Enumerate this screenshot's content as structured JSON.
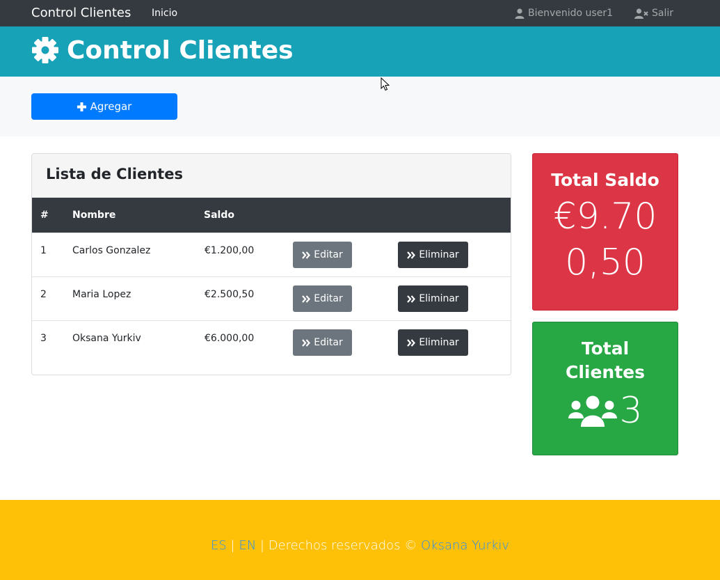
{
  "navbar": {
    "brand": "Control Clientes",
    "home": "Inicio",
    "welcome": "Bienvenido user1",
    "logout": "Salir",
    "user_icon": "user-icon",
    "logout_icon": "user-times-icon"
  },
  "header": {
    "title": "Control Clientes",
    "icon": "gear-icon"
  },
  "actions": {
    "add_label": "Agregar",
    "add_icon": "plus-icon"
  },
  "clients_card": {
    "title": "Lista de Clientes",
    "columns": [
      "#",
      "Nombre",
      "Saldo"
    ],
    "rows": [
      {
        "id": "1",
        "name": "Carlos Gonzalez",
        "balance": "€1.200,00",
        "edit": "Editar",
        "delete": "Eliminar"
      },
      {
        "id": "2",
        "name": "Maria Lopez",
        "balance": "€2.500,50",
        "edit": "Editar",
        "delete": "Eliminar"
      },
      {
        "id": "3",
        "name": "Oksana Yurkiv",
        "balance": "€6.000,00",
        "edit": "Editar",
        "delete": "Eliminar"
      }
    ]
  },
  "stats": {
    "total_balance_title": "Total Saldo",
    "total_balance_value": "€9.700,50",
    "total_clients_title": "Total Clientes",
    "total_clients_value": "3",
    "clients_icon": "users-icon"
  },
  "footer": {
    "lang_es": "ES",
    "sep1": " | ",
    "lang_en": "EN",
    "sep2": " | ",
    "rights": "Derechos reservados © ",
    "author": "Oksana Yurkiv"
  },
  "colors": {
    "navbar": "#343a40",
    "header": "#17a2b8",
    "primary": "#007bff",
    "danger": "#dc3545",
    "success": "#28a745",
    "footer": "#ffc107"
  }
}
